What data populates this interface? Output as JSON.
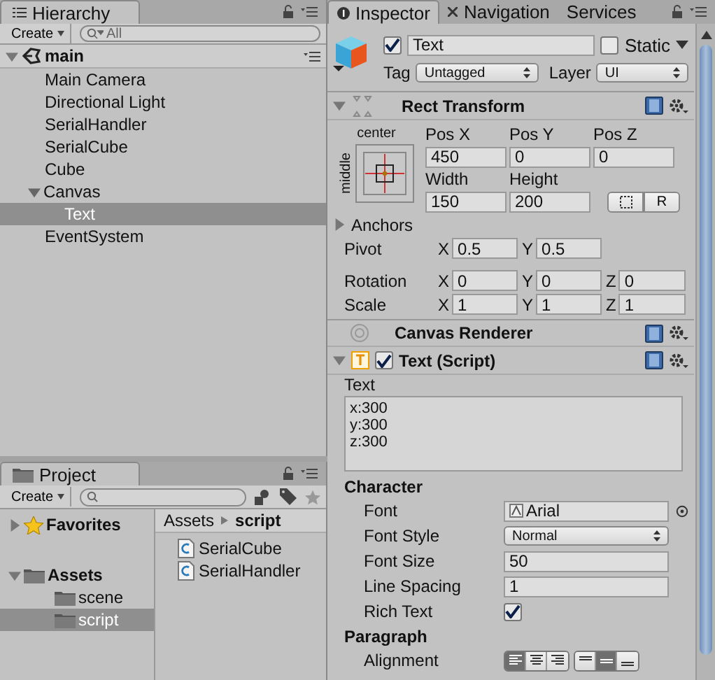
{
  "hierarchy": {
    "tab": "Hierarchy",
    "create": "Create",
    "search": {
      "placeholder": "All"
    },
    "scene": "main",
    "items": [
      {
        "label": "Main Camera",
        "selected": false
      },
      {
        "label": "Directional Light",
        "selected": false
      },
      {
        "label": "SerialHandler",
        "selected": false
      },
      {
        "label": "SerialCube",
        "selected": false
      },
      {
        "label": "Cube",
        "selected": false
      },
      {
        "label": "Canvas",
        "selected": false,
        "expanded": true,
        "children": [
          {
            "label": "Text",
            "selected": true
          }
        ]
      },
      {
        "label": "EventSystem",
        "selected": false
      }
    ]
  },
  "project": {
    "tab": "Project",
    "create": "Create",
    "tree": [
      {
        "label": "Favorites",
        "kind": "favorites",
        "expanded": false,
        "selected": false
      },
      {
        "label": "Assets",
        "kind": "folder",
        "expanded": true,
        "selected": false,
        "children": [
          {
            "label": "scene",
            "kind": "folder",
            "selected": false
          },
          {
            "label": "script",
            "kind": "folder",
            "selected": true
          }
        ]
      }
    ],
    "breadcrumb": [
      "Assets",
      "script"
    ],
    "files": [
      "SerialCube",
      "SerialHandler"
    ]
  },
  "inspector": {
    "tabs": [
      {
        "label": "Inspector",
        "selected": true
      },
      {
        "label": "Navigation",
        "selected": false
      },
      {
        "label": "Services",
        "selected": false
      }
    ],
    "object": {
      "active": true,
      "name": "Text",
      "static": false,
      "static_label": "Static",
      "tag_label": "Tag",
      "tag": "Untagged",
      "layer_label": "Layer",
      "layer": "UI"
    },
    "rect_transform": {
      "title": "Rect Transform",
      "anchor_horizontal": "center",
      "anchor_vertical": "middle",
      "top_fields": [
        {
          "label": "Pos X",
          "value": "450"
        },
        {
          "label": "Pos Y",
          "value": "0"
        },
        {
          "label": "Pos Z",
          "value": "0"
        }
      ],
      "size_fields": [
        {
          "label": "Width",
          "value": "150"
        },
        {
          "label": "Height",
          "value": "200"
        }
      ],
      "raw_button": "R",
      "anchors_label": "Anchors",
      "vectors": [
        {
          "label": "Pivot",
          "axes": [
            {
              "axis": "X",
              "value": "0.5"
            },
            {
              "axis": "Y",
              "value": "0.5"
            }
          ]
        },
        {
          "label": "Rotation",
          "axes": [
            {
              "axis": "X",
              "value": "0"
            },
            {
              "axis": "Y",
              "value": "0"
            },
            {
              "axis": "Z",
              "value": "0"
            }
          ]
        },
        {
          "label": "Scale",
          "axes": [
            {
              "axis": "X",
              "value": "1"
            },
            {
              "axis": "Y",
              "value": "1"
            },
            {
              "axis": "Z",
              "value": "1"
            }
          ]
        }
      ]
    },
    "canvas_renderer": {
      "title": "Canvas Renderer"
    },
    "text_script": {
      "title": "Text (Script)",
      "enabled": true,
      "text_label": "Text",
      "text_lines": [
        "x:300",
        "y:300",
        "z:300"
      ],
      "character_heading": "Character",
      "properties": [
        {
          "kind": "object",
          "label": "Font",
          "value": "Arial"
        },
        {
          "kind": "dropdown",
          "label": "Font Style",
          "value": "Normal"
        },
        {
          "kind": "field",
          "label": "Font Size",
          "value": "50"
        },
        {
          "kind": "field",
          "label": "Line Spacing",
          "value": "1"
        },
        {
          "kind": "checkbox",
          "label": "Rich Text",
          "checked": true
        }
      ],
      "paragraph_heading": "Paragraph",
      "alignment": {
        "label": "Alignment",
        "horizontal": [
          {
            "selected": true
          },
          {
            "selected": false
          },
          {
            "selected": false
          }
        ],
        "vertical": [
          {
            "selected": false
          },
          {
            "selected": true
          },
          {
            "selected": false
          }
        ]
      }
    }
  }
}
